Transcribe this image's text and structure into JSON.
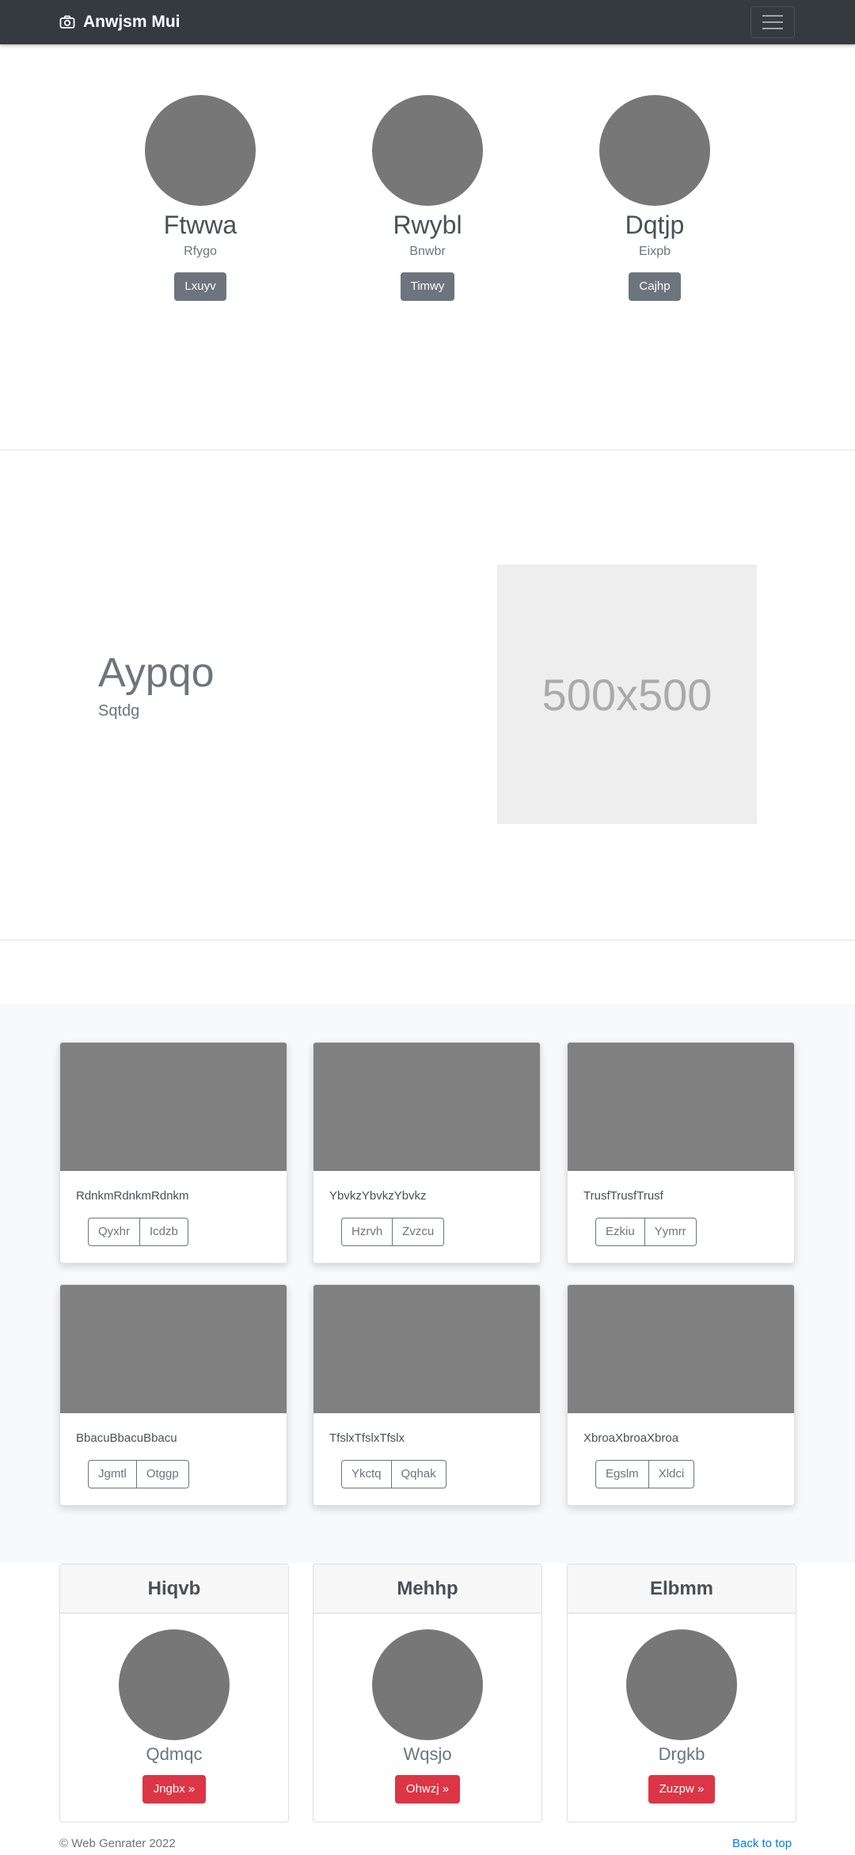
{
  "navbar": {
    "brand": "Anwjsm Mui",
    "brand_icon": "camera-icon",
    "toggle_icon": "hamburger-icon"
  },
  "profiles": [
    {
      "name": "Ftwwa",
      "subtitle": "Rfygo",
      "button": "Lxuyv"
    },
    {
      "name": "Rwybl",
      "subtitle": "Bnwbr",
      "button": "Timwy"
    },
    {
      "name": "Dqtjp",
      "subtitle": "Eixpb",
      "button": "Cajhp"
    }
  ],
  "feature": {
    "title": "Aypqo",
    "subtitle": "Sqtdg",
    "image_label": "500x500"
  },
  "album": [
    {
      "text": "RdnkmRdnkmRdnkm",
      "buttons": [
        "Qyxhr",
        "Icdzb"
      ]
    },
    {
      "text": "YbvkzYbvkzYbvkz",
      "buttons": [
        "Hzrvh",
        "Zvzcu"
      ]
    },
    {
      "text": "TrusfTrusfTrusf",
      "buttons": [
        "Ezkiu",
        "Yymrr"
      ]
    },
    {
      "text": "BbacuBbacuBbacu",
      "buttons": [
        "Jgmtl",
        "Otggp"
      ]
    },
    {
      "text": "TfslxTfslxTfslx",
      "buttons": [
        "Ykctq",
        "Qqhak"
      ]
    },
    {
      "text": "XbroaXbroaXbroa",
      "buttons": [
        "Egslm",
        "Xldci"
      ]
    }
  ],
  "pricing": [
    {
      "header": "Hiqvb",
      "name": "Qdmqc",
      "button": "Jngbx »"
    },
    {
      "header": "Mehhp",
      "name": "Wqsjo",
      "button": "Ohwzj »"
    },
    {
      "header": "Elbmm",
      "name": "Drgkb",
      "button": "Zuzpw »"
    }
  ],
  "footer": {
    "copyright": "© Web Genrater 2022",
    "back_to_top": "Back to top"
  },
  "colors": {
    "navbar": "#343a40",
    "secondary": "#6c757d",
    "danger": "#dc3545",
    "link": "#007bff"
  }
}
